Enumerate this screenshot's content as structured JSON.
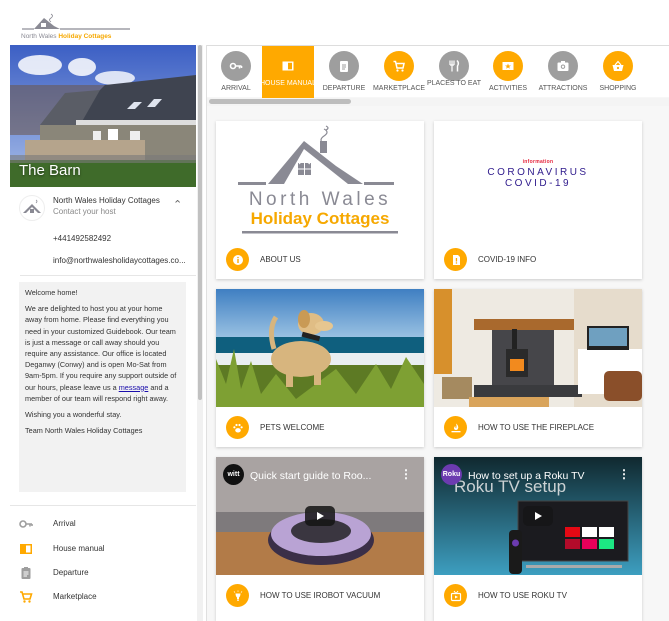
{
  "brand": {
    "name_part1": "North Wales ",
    "name_part2": "Holiday Cottages",
    "accent_color": "#ffa900",
    "grey_color": "#9e9e9e"
  },
  "property": {
    "title": "The Barn"
  },
  "host": {
    "name": "North Wales Holiday Cottages",
    "subtitle": "Contact your host",
    "phone": "+441492582492",
    "email": "info@northwalesholidaycottages.co..."
  },
  "welcome": {
    "greeting": "Welcome home!",
    "body_before_link": "We are delighted to host you at your home away from home. Please find everything you need in your customized Guidebook. Our team is just a message or call away should you require any assistance. Our office is located Deganwy (Conwy) and is open Mo-Sat from 9am-5pm. If you require any support outside of our hours, please leave us a ",
    "link_text": "message",
    "body_after_link": " and a member of our team will respond right away.",
    "wish": "Wishing you a wonderful stay.",
    "signoff": "Team North Wales Holiday Cottages"
  },
  "sidebar_nav": [
    {
      "label": "Arrival",
      "icon": "key-icon",
      "color": "#9e9e9e"
    },
    {
      "label": "House manual",
      "icon": "book-icon",
      "color": "#ffa900"
    },
    {
      "label": "Departure",
      "icon": "clipboard-icon",
      "color": "#9e9e9e"
    },
    {
      "label": "Marketplace",
      "icon": "cart-icon",
      "color": "#ffa900"
    }
  ],
  "tabs": [
    {
      "label": "ARRIVAL",
      "icon": "key-icon",
      "color": "#9e9e9e",
      "active": false
    },
    {
      "label": "HOUSE MANUAL",
      "icon": "book-icon",
      "color": "#ffa900",
      "active": true
    },
    {
      "label": "DEPARTURE",
      "icon": "clipboard-icon",
      "color": "#9e9e9e",
      "active": false
    },
    {
      "label": "MARKETPLACE",
      "icon": "cart-icon",
      "color": "#ffa900",
      "active": false
    },
    {
      "label": "PLACES TO EAT",
      "icon": "utensils-icon",
      "color": "#9e9e9e",
      "active": false
    },
    {
      "label": "ACTIVITIES",
      "icon": "ticket-icon",
      "color": "#ffa900",
      "active": false
    },
    {
      "label": "ATTRACTIONS",
      "icon": "camera-icon",
      "color": "#9e9e9e",
      "active": false
    },
    {
      "label": "SHOPPING",
      "icon": "basket-icon",
      "color": "#ffa900",
      "active": false
    }
  ],
  "cards": [
    {
      "label": "ABOUT US",
      "icon": "info-icon",
      "media": "logo"
    },
    {
      "label": "COVID-19 INFO",
      "icon": "alert-card-icon",
      "media": "covid",
      "media_small": "information",
      "media_line1": "CORONAVIRUS",
      "media_line2": "COVID-19"
    },
    {
      "label": "PETS WELCOME",
      "icon": "paw-icon",
      "media": "dog-photo"
    },
    {
      "label": "HOW TO USE THE FIREPLACE",
      "icon": "fire-icon",
      "media": "fireplace-photo"
    },
    {
      "label": "HOW TO USE IROBOT VACUUM",
      "icon": "lightbulb-icon",
      "media": "video",
      "video_title": "Quick start guide to Roo...",
      "channel": "witt"
    },
    {
      "label": "HOW TO USE ROKU TV",
      "icon": "tv-icon",
      "media": "video",
      "video_title": "How to set up a Roku TV",
      "channel": "Roku",
      "overlay_text": "Roku TV setup"
    }
  ]
}
